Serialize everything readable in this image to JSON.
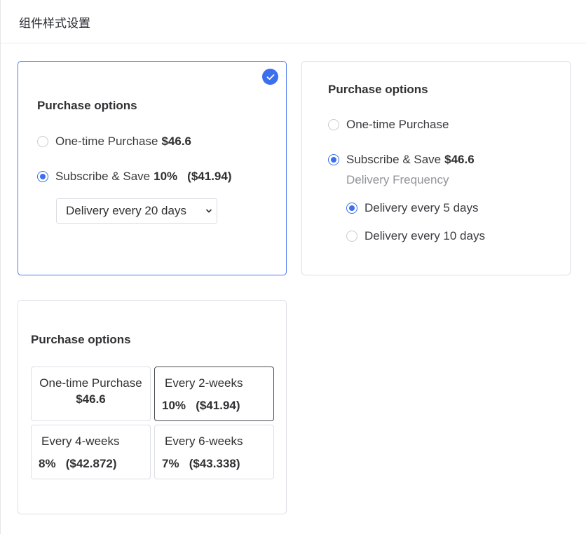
{
  "header": {
    "title": "组件样式设置"
  },
  "card1": {
    "title": "Purchase options",
    "options": [
      {
        "label": "One-time Purchase",
        "price": "$46.6",
        "checked": false
      },
      {
        "label": "Subscribe & Save",
        "discount": "10%",
        "price": "($41.94)",
        "checked": true
      }
    ],
    "select": {
      "value": "Delivery every 20 days"
    },
    "selected_badge": "check-icon"
  },
  "card2": {
    "title": "Purchase options",
    "options": [
      {
        "label": "One-time Purchase",
        "checked": false
      },
      {
        "label": "Subscribe & Save",
        "price": "$46.6",
        "checked": true
      }
    ],
    "frequency_label": "Delivery Frequency",
    "frequencies": [
      {
        "label": "Delivery every 5 days",
        "checked": true
      },
      {
        "label": "Delivery every 10 days",
        "checked": false
      }
    ]
  },
  "card3": {
    "title": "Purchase options",
    "tiles": [
      {
        "line1": "One-time Purchase",
        "line2": "$46.6",
        "active": false
      },
      {
        "line1": "Every 2-weeks",
        "line2": "10%   ($41.94)",
        "active": true
      },
      {
        "line1": "Every 4-weeks",
        "line2": "8%   ($42.872)",
        "active": false
      },
      {
        "line1": "Every 6-weeks",
        "line2": "7%   ($43.338)",
        "active": false
      }
    ]
  },
  "colors": {
    "accent": "#3b6ff0",
    "selected_border": "#4f7cf2"
  }
}
